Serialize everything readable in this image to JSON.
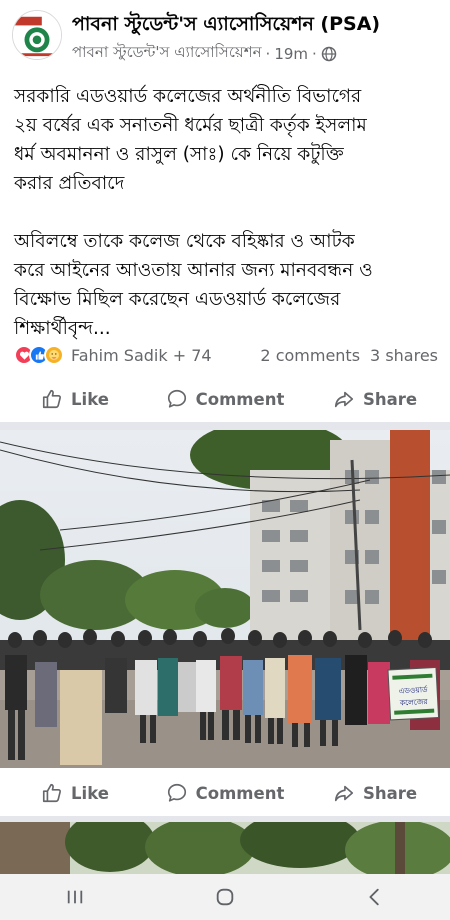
{
  "post": {
    "page_name": "পাবনা স্টুডেন্ট'স এ্যাসোসিয়েশন (PSA)",
    "sub_name": "পাবনা স্টুডেন্ট'স এ্যাসোসিয়েশন",
    "time": "19m",
    "separator": "·",
    "audience_icon": "globe-icon",
    "text": "সরকারি এডওয়ার্ড কলেজের অর্থনীতি বিভাগের\n২য় বর্ষের এক সনাতনী ধর্মের ছাত্রী কর্তৃক ইসলাম\nধর্ম অবমাননা ও রাসুল (সাঃ) কে নিয়ে কটুক্তি\nকরার প্রতিবাদে\n\nঅবিলম্বে তাকে কলেজ থেকে বহিষ্কার ও আটক\nকরে আইনের আওতায় আনার জন্য মানববন্ধন ও\nবিক্ষোভ মিছিল করেছেন এডওয়ার্ড কলেজের\nশিক্ষার্থীবৃন্দ..."
  },
  "reactions": {
    "icons": [
      "love-icon",
      "like-icon",
      "care-icon"
    ],
    "reactors": "Fahim Sadik + 74",
    "comments": "2 comments",
    "shares": "3 shares"
  },
  "actions": {
    "like": "Like",
    "comment": "Comment",
    "share": "Share"
  },
  "photo": {
    "banner_text_1": "এডওয়ার্ড",
    "banner_text_2": "কলেজের"
  },
  "colors": {
    "text": "#050505",
    "muted": "#65676b",
    "divider": "#e4e6eb",
    "love": "#f33e58",
    "like": "#1877f2",
    "care": "#f7b125"
  },
  "nav": {
    "recents_icon": "recents-icon",
    "home_icon": "home-icon",
    "back_icon": "back-icon"
  }
}
